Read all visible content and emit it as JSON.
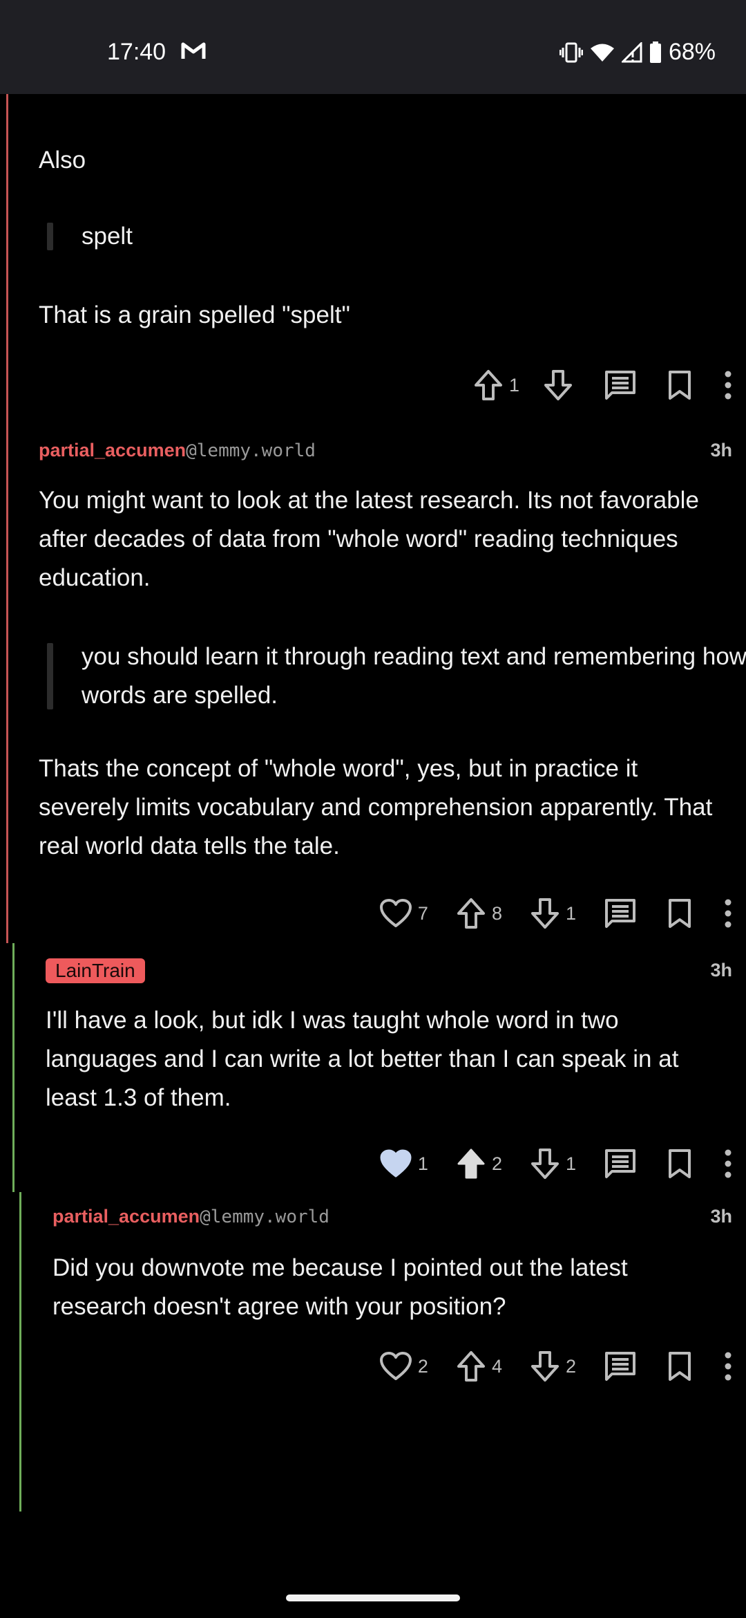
{
  "status_bar": {
    "time": "17:40",
    "battery": "68%",
    "icons": [
      "gmail-icon",
      "vibrate-icon",
      "wifi-icon",
      "signal-icon",
      "battery-icon"
    ]
  },
  "comment_1": {
    "paragraph_1": "Also",
    "quote": "spelt",
    "paragraph_2": "That is a grain spelled \"spelt\"",
    "upvotes": "1"
  },
  "comment_2": {
    "author": "partial_accumen",
    "instance": "@lemmy.world",
    "time": "3h",
    "paragraph_1": "You might want to look at the latest research.  Its not favorable after decades of data from \"whole word\" reading techniques education.",
    "quote": "you should learn it through reading text and remembering how words are spelled.",
    "paragraph_2": "Thats the concept of \"whole word\", yes, but in practice it severely limits vocabulary and comprehension apparently.  That real world data tells the tale.",
    "likes": "7",
    "upvotes": "8",
    "downvotes": "1"
  },
  "comment_3": {
    "author": "LainTrain",
    "time": "3h",
    "body": "I'll have a look, but idk I was taught whole word in two languages and I can write a lot better than I can speak in at least 1.3 of them.",
    "likes": "1",
    "upvotes": "2",
    "downvotes": "1"
  },
  "comment_4": {
    "author": "partial_accumen",
    "instance": "@lemmy.world",
    "time": "3h",
    "body": "Did you downvote me because I pointed out the latest research doesn't agree with your position?",
    "likes": "2",
    "upvotes": "4",
    "downvotes": "2"
  },
  "colors": {
    "background": "#000000",
    "author": "#e95f60",
    "op_badge": "#ee5a5c",
    "thread_depth_1": "#c65454",
    "thread_depth_2": "#6fae5a",
    "liked_heart": "#c6d5f0"
  }
}
